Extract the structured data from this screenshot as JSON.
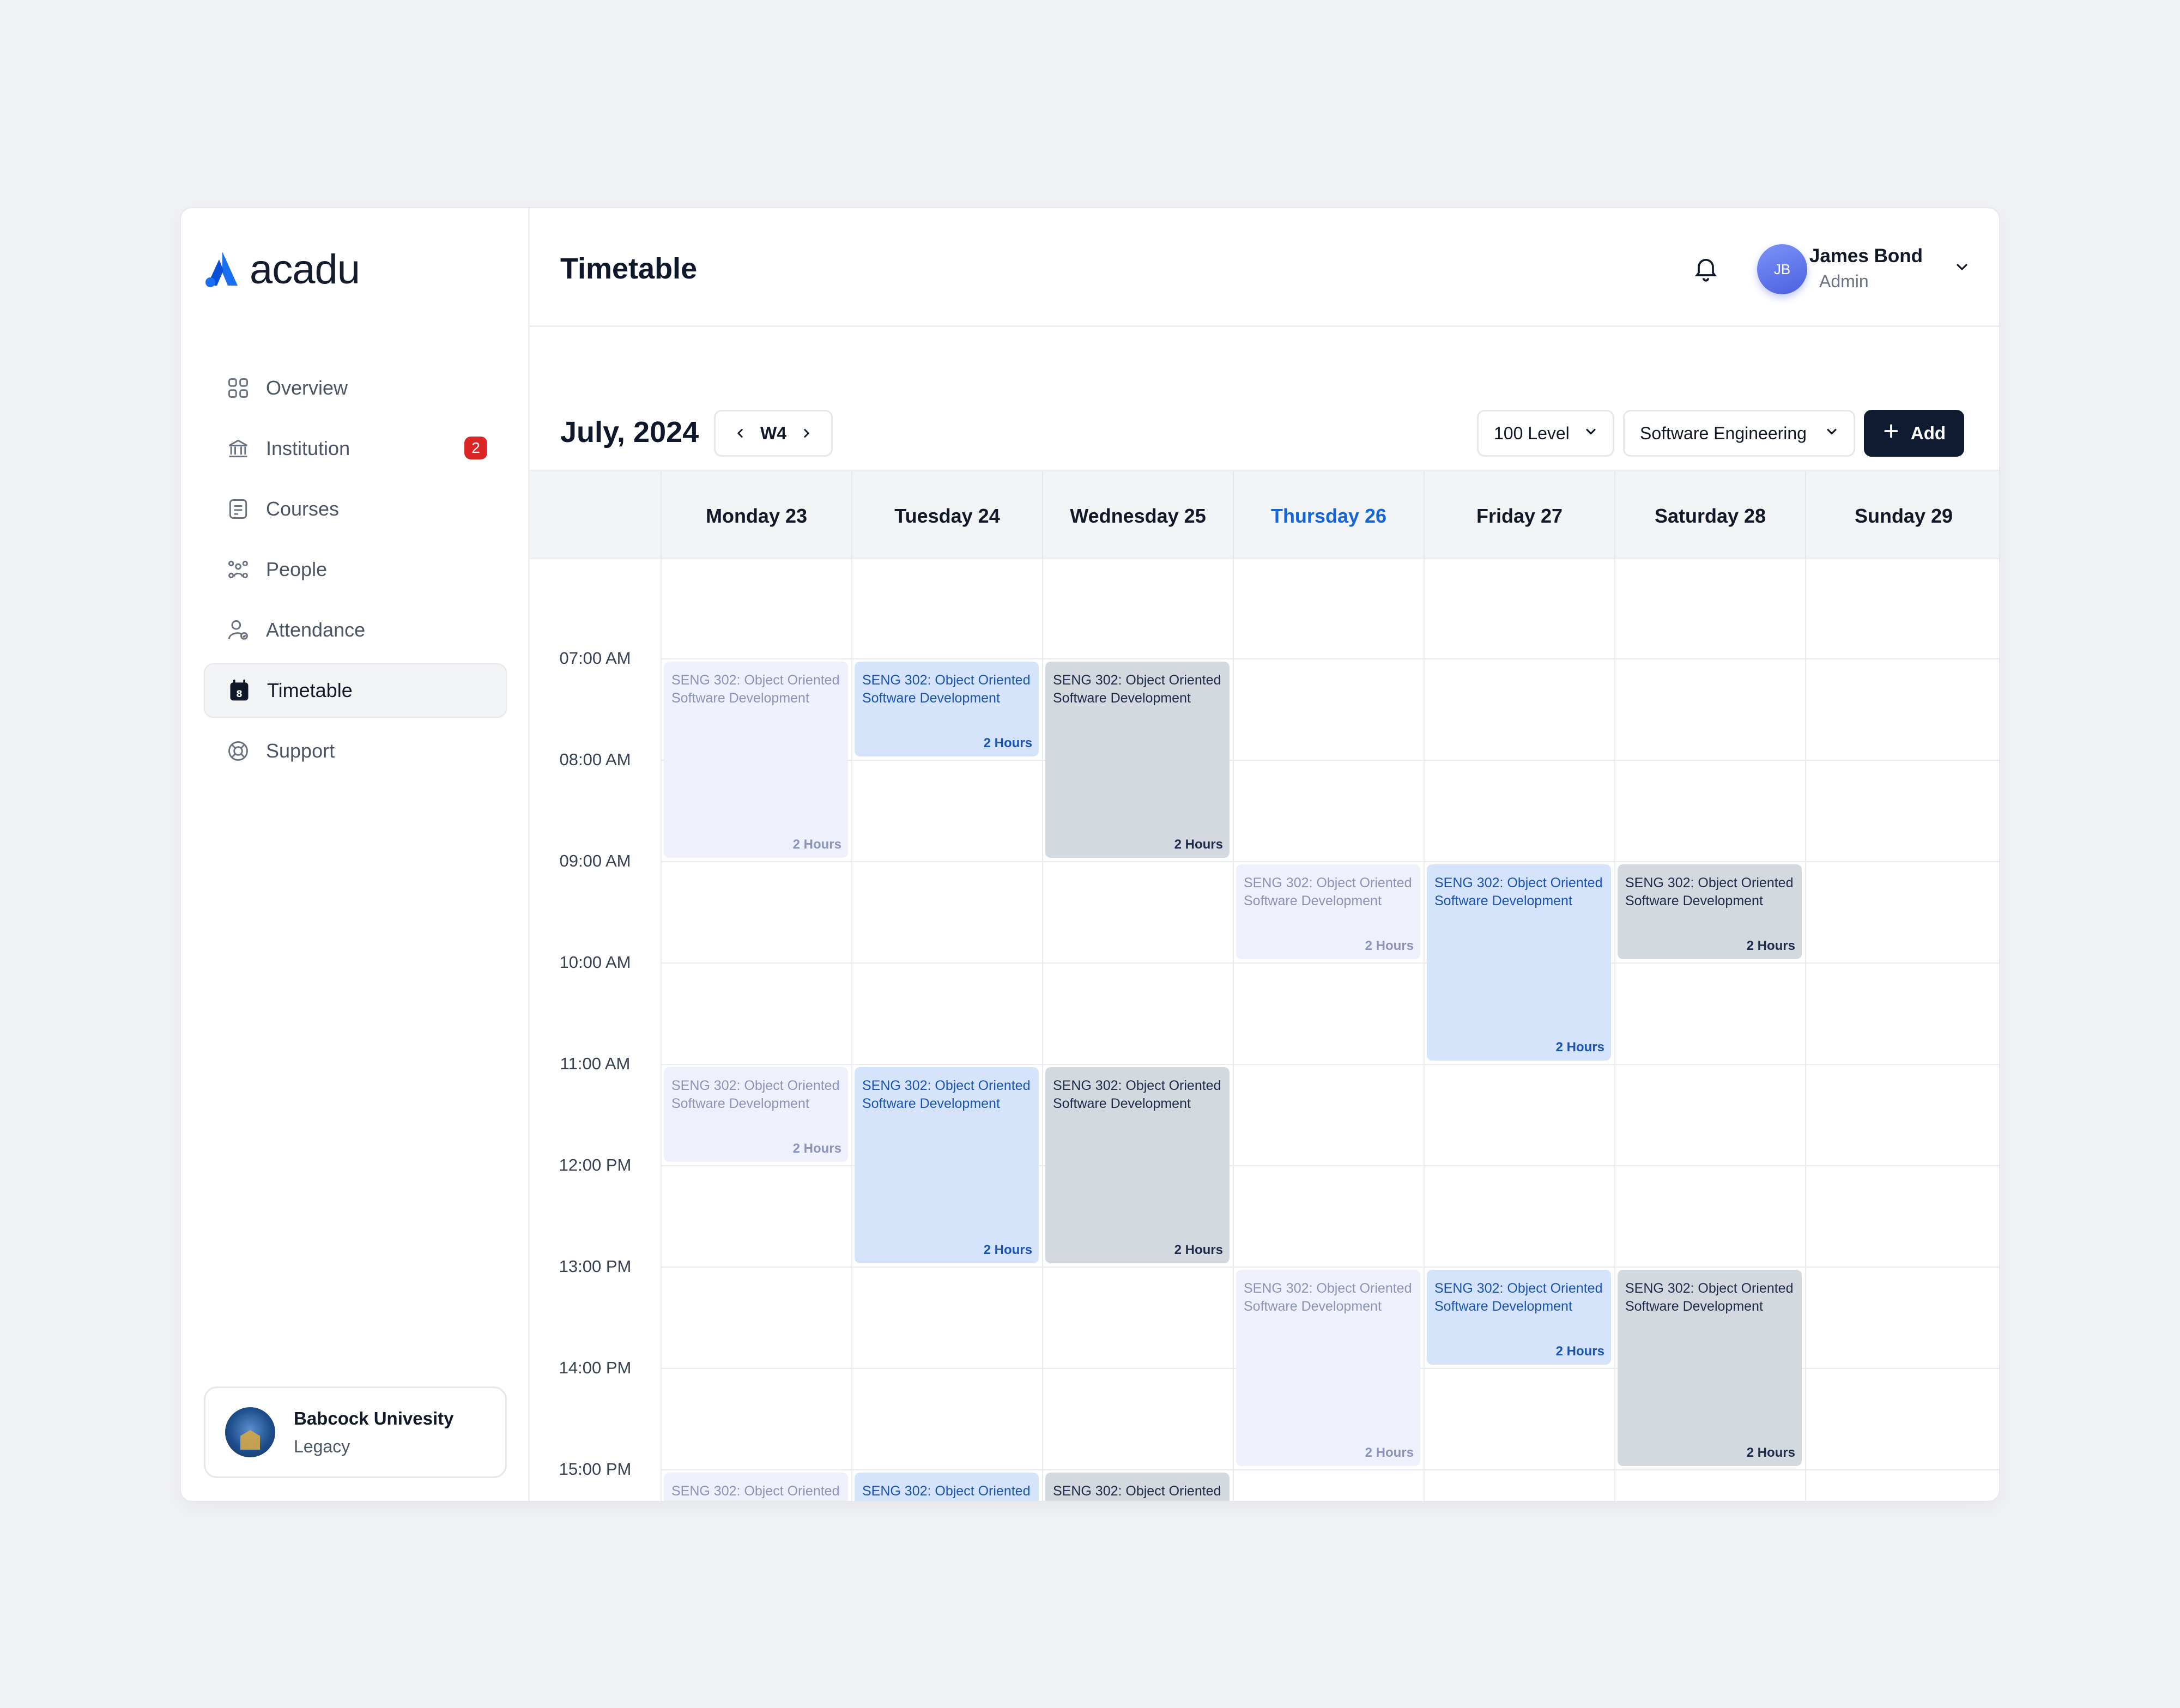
{
  "brand": {
    "name": "acadu"
  },
  "sidebar": {
    "items": [
      {
        "label": "Overview",
        "icon": "grid-icon"
      },
      {
        "label": "Institution",
        "icon": "institution-icon",
        "badge": "2"
      },
      {
        "label": "Courses",
        "icon": "document-icon"
      },
      {
        "label": "People",
        "icon": "people-icon"
      },
      {
        "label": "Attendance",
        "icon": "user-check-icon"
      },
      {
        "label": "Timetable",
        "icon": "calendar-icon",
        "active": true
      },
      {
        "label": "Support",
        "icon": "lifebuoy-icon"
      }
    ],
    "institution": {
      "name": "Babcock Univesity",
      "subtitle": "Legacy"
    }
  },
  "header": {
    "title": "Timetable",
    "user": {
      "initials": "JB",
      "name": "James Bond",
      "role": "Admin"
    }
  },
  "toolbar": {
    "month": "July, 2024",
    "week": "W4",
    "level": "100 Level",
    "department": "Software Engineering",
    "add_label": "Add"
  },
  "calendar": {
    "days": [
      {
        "label": "Monday 23"
      },
      {
        "label": "Tuesday  24"
      },
      {
        "label": "Wednesday 25"
      },
      {
        "label": "Thursday 26",
        "today": true
      },
      {
        "label": "Friday 27"
      },
      {
        "label": "Saturday 28"
      },
      {
        "label": "Sunday 29"
      }
    ],
    "times": [
      "07:00 AM",
      "08:00 AM",
      "09:00 AM",
      "10:00 AM",
      "11:00 AM",
      "12:00 PM",
      "13:00 PM",
      "14:00 PM",
      "15:00 PM"
    ],
    "event_title": "SENG 302: Object Oriented Software Development",
    "events": [
      {
        "day": 0,
        "start": "07:00",
        "rows": 2,
        "style": "light",
        "title": "SENG 302: Object Oriented Software Development",
        "duration": "2 Hours"
      },
      {
        "day": 1,
        "start": "07:00",
        "rows": 1,
        "style": "blue",
        "title": "SENG 302: Object Oriented Software Development",
        "duration": "2 Hours"
      },
      {
        "day": 2,
        "start": "07:00",
        "rows": 2,
        "style": "gray",
        "title": "SENG 302: Object Oriented Software Development",
        "duration": "2 Hours"
      },
      {
        "day": 3,
        "start": "09:00",
        "rows": 1,
        "style": "light",
        "title": "SENG 302: Object Oriented Software Development",
        "duration": "2 Hours"
      },
      {
        "day": 4,
        "start": "09:00",
        "rows": 2,
        "style": "blue",
        "title": "SENG 302: Object Oriented Software Development",
        "duration": "2 Hours"
      },
      {
        "day": 5,
        "start": "09:00",
        "rows": 1,
        "style": "gray",
        "title": "SENG 302: Object Oriented Software Development",
        "duration": "2 Hours"
      },
      {
        "day": 0,
        "start": "11:00",
        "rows": 1,
        "style": "light",
        "title": "SENG 302: Object Oriented Software Development",
        "duration": "2 Hours"
      },
      {
        "day": 1,
        "start": "11:00",
        "rows": 2,
        "style": "blue",
        "title": "SENG 302: Object Oriented Software Development",
        "duration": "2 Hours"
      },
      {
        "day": 2,
        "start": "11:00",
        "rows": 2,
        "style": "gray",
        "title": "SENG 302: Object Oriented Software Development",
        "duration": "2 Hours"
      },
      {
        "day": 3,
        "start": "13:00",
        "rows": 2,
        "style": "light",
        "title": "SENG 302: Object Oriented Software Development",
        "duration": "2 Hours"
      },
      {
        "day": 4,
        "start": "13:00",
        "rows": 1,
        "style": "blue",
        "title": "SENG 302: Object Oriented Software Development",
        "duration": "2 Hours"
      },
      {
        "day": 5,
        "start": "13:00",
        "rows": 2,
        "style": "gray",
        "title": "SENG 302: Object Oriented Software Development",
        "duration": "2 Hours"
      },
      {
        "day": 0,
        "start": "15:00",
        "rows": 2,
        "style": "light",
        "title": "SENG 302: Object Oriented",
        "duration": ""
      },
      {
        "day": 1,
        "start": "15:00",
        "rows": 2,
        "style": "blue",
        "title": "SENG 302: Object Oriented",
        "duration": ""
      },
      {
        "day": 2,
        "start": "15:00",
        "rows": 2,
        "style": "gray",
        "title": "SENG 302: Object Oriented",
        "duration": ""
      }
    ]
  },
  "colors": {
    "accent": "#1565d8",
    "primary_button": "#0f1b30",
    "badge": "#dc2626",
    "event_light": "#eef1fb",
    "event_blue": "#d5e4fb",
    "event_gray": "#d4d8df"
  }
}
